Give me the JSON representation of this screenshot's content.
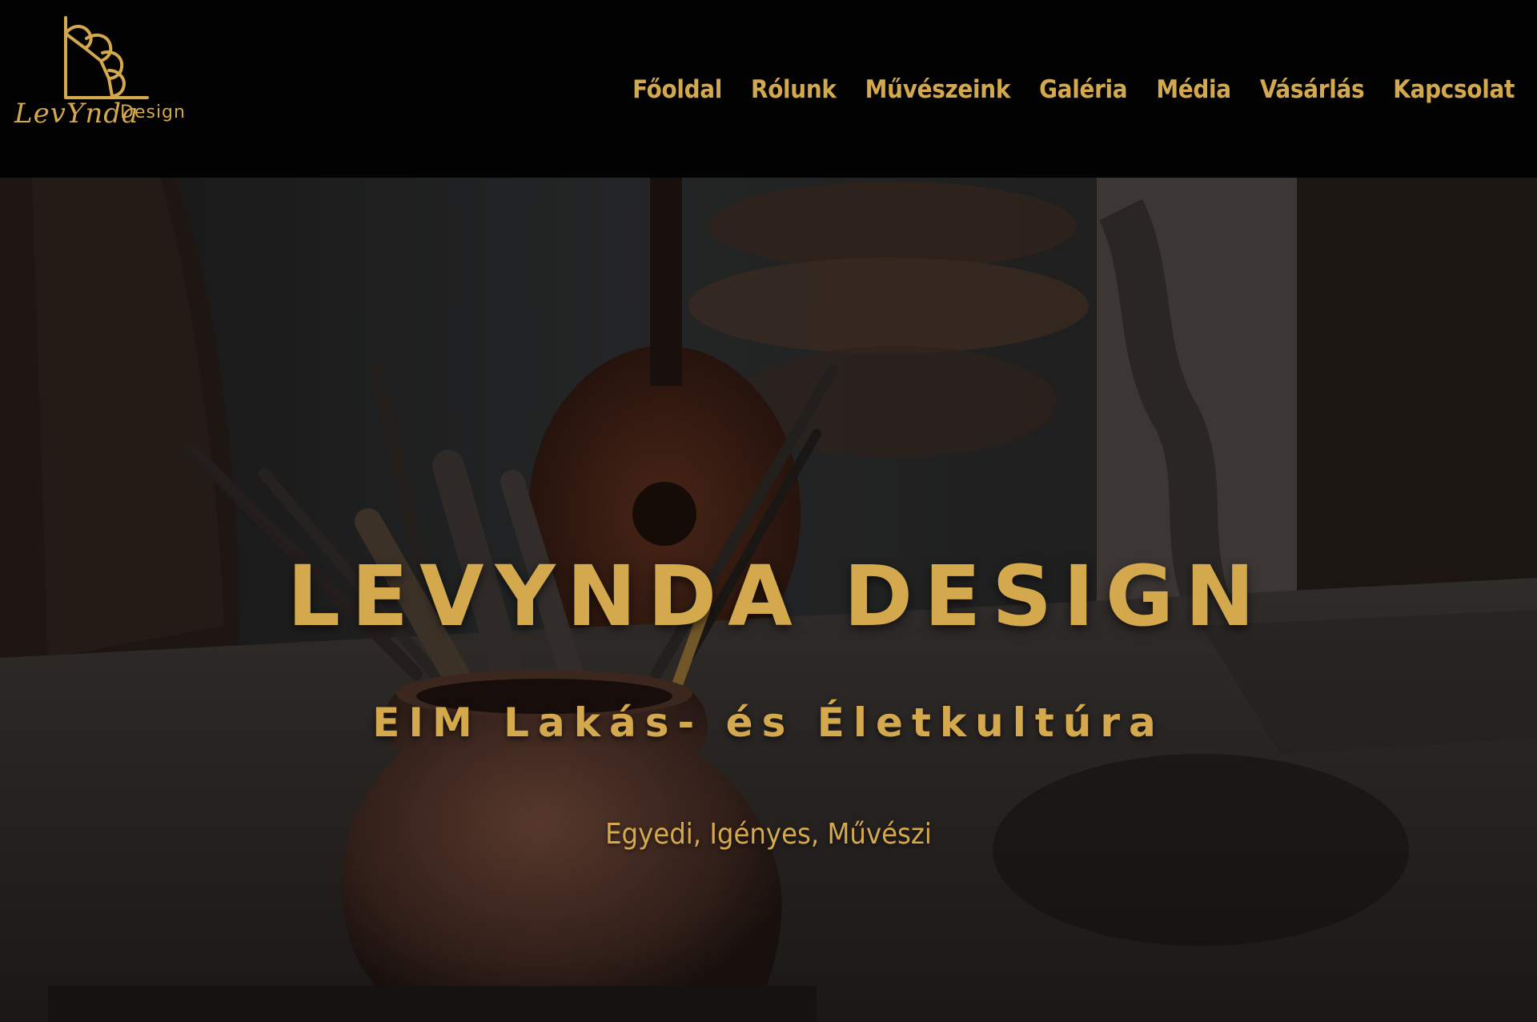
{
  "header": {
    "logo": {
      "script_text": "LevYnda",
      "design_text": "Design",
      "icon": "fan-shell-logo-icon"
    },
    "nav": [
      {
        "label": "Főoldal"
      },
      {
        "label": "Rólunk"
      },
      {
        "label": "Művészeink"
      },
      {
        "label": "Galéria"
      },
      {
        "label": "Média"
      },
      {
        "label": "Vásárlás"
      },
      {
        "label": "Kapcsolat"
      }
    ]
  },
  "hero": {
    "title": "LEVYNDA DESIGN",
    "subtitle": "EIM Lakás- és Életkultúra",
    "tagline": "Egyedi, Igényes, Művészi",
    "background": "art-studio-brushes-in-clay-pot"
  },
  "colors": {
    "accent": "#d4a84d",
    "header_bg": "#020202"
  }
}
